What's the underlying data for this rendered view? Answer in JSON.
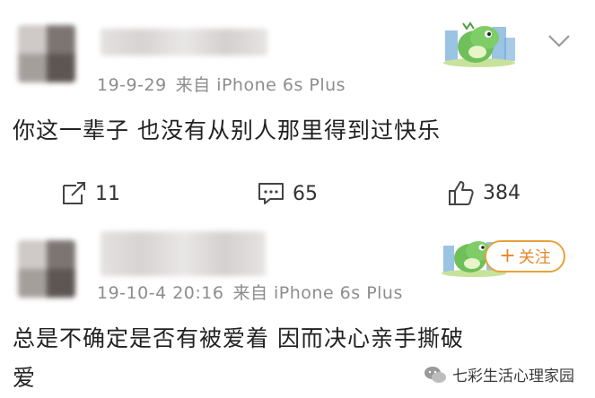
{
  "posts": [
    {
      "date": "19-9-29",
      "source": "来自 iPhone 6s Plus",
      "text": "你这一辈子 也没有从别人那里得到过快乐",
      "actions": {
        "repost": "11",
        "comment": "65",
        "like": "384"
      }
    },
    {
      "date": "19-10-4 20:16",
      "source": "来自 iPhone 6s Plus",
      "text_line1": "总是不确定是否有被爱着 因而决心亲手撕破",
      "text_line2": "爱",
      "follow_label": "关注",
      "follow_plus": "+"
    }
  ],
  "watermark": "七彩生活心理家园",
  "colors": {
    "follow_border": "#e8a13a",
    "follow_text": "#e8862a",
    "badge_green": "#6fbf5a"
  }
}
